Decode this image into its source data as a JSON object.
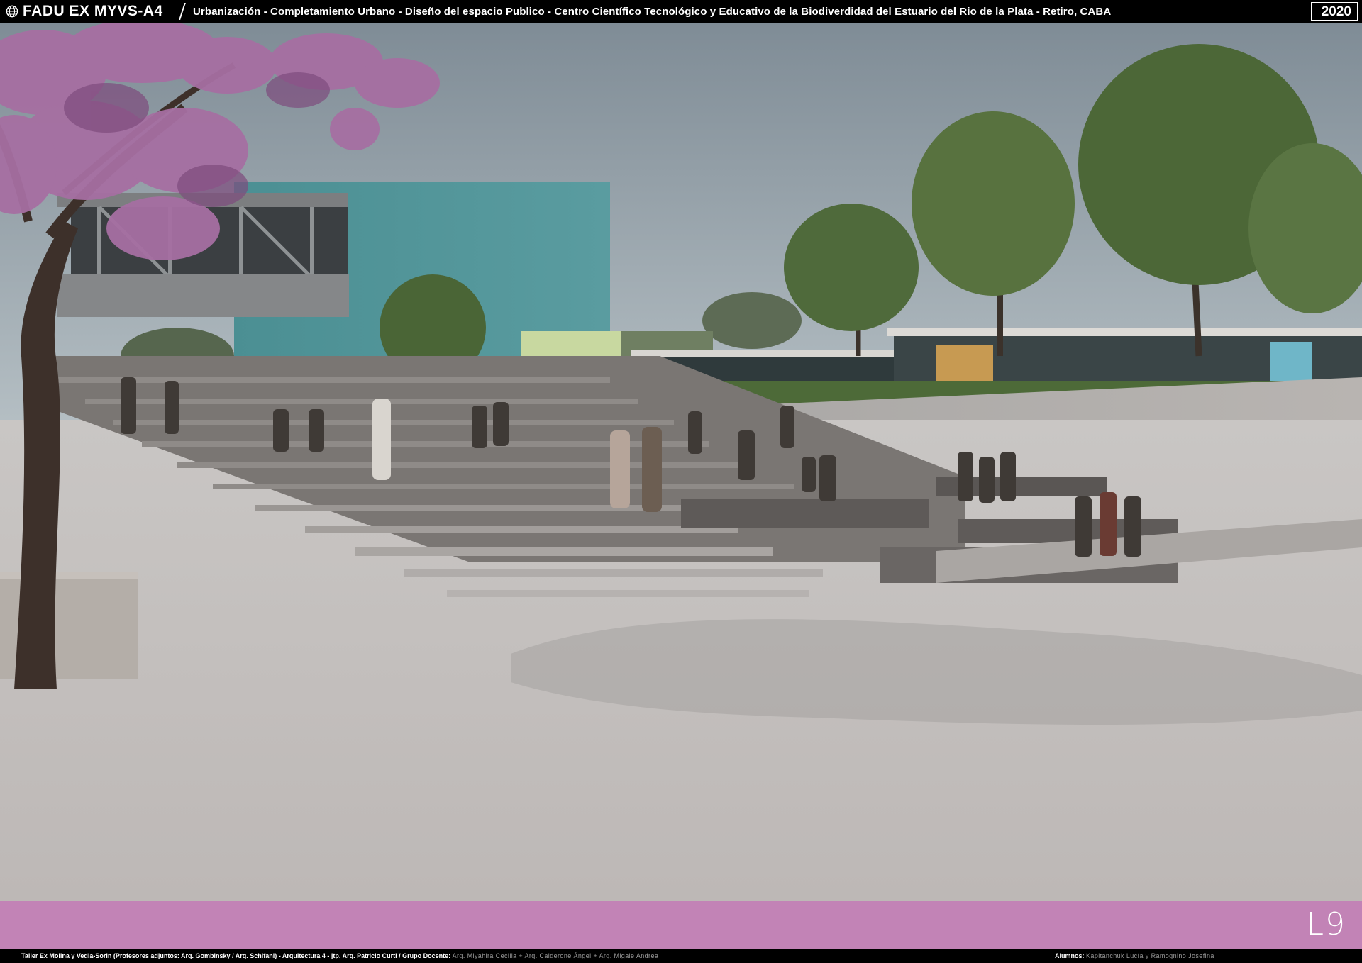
{
  "header": {
    "brand": "FADU EX MYVS-A4",
    "subtitle": "Urbanización - Completamiento Urbano - Diseño del espacio Publico - Centro Científico Tecnológico y Educativo de la Biodiverdidad del Estuario del Rio de la Plata   - Retiro, CABA",
    "year": "2020"
  },
  "sheet": {
    "number": "L9",
    "band_color": "#c283b6"
  },
  "footer": {
    "studio_label": "Taller Ex Molina y Vedia-Sorin (Profesores adjuntos:  Arq. Gombinsky / Arq. Schifani) - Arquitectura 4 - jtp. Arq. Patricio Curti / Grupo Docente:",
    "teachers": "Arq. Miyahira Cecilia  +  Arq. Calderone Ángel  +  Arq. Migale Andrea",
    "students_label": "Alumnos:",
    "students": "Kapitanchuk Lucía  y  Ramognino Josefina"
  },
  "icons": {
    "logo": "globe-icon"
  }
}
